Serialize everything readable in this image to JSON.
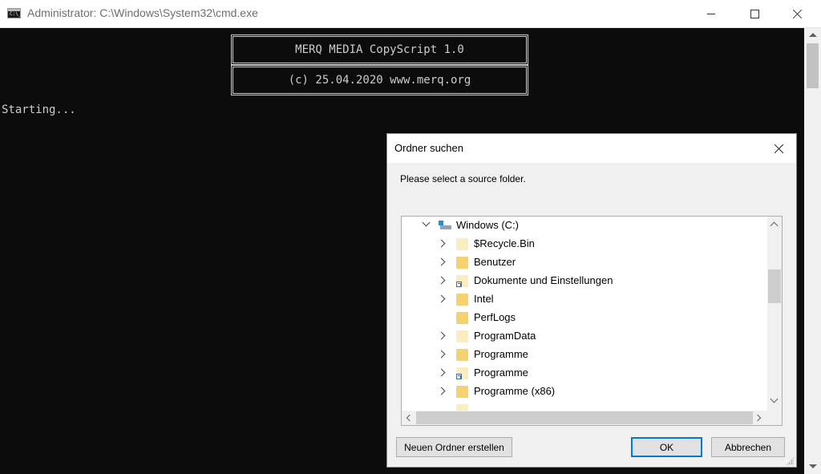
{
  "window": {
    "title": "Administrator: C:\\Windows\\System32\\cmd.exe",
    "icon": "cmd-icon",
    "icon_text": "C:\\_"
  },
  "console": {
    "banner_line1": "MERQ MEDIA CopyScript 1.0",
    "banner_line2": "(c) 25.04.2020 www.merq.org",
    "output_line": "Starting..."
  },
  "dialog": {
    "title": "Ordner suchen",
    "prompt": "Please select a source folder.",
    "tree": {
      "root": {
        "label": "Windows (C:)",
        "icon": "drive-icon",
        "expanded": true
      },
      "items": [
        {
          "label": "$Recycle.Bin",
          "icon": "folder-icon",
          "expandable": true,
          "style": "pale"
        },
        {
          "label": "Benutzer",
          "icon": "folder-icon",
          "expandable": true,
          "style": "normal"
        },
        {
          "label": "Dokumente und Einstellungen",
          "icon": "folder-shortcut-icon",
          "expandable": true,
          "style": "pale"
        },
        {
          "label": "Intel",
          "icon": "folder-icon",
          "expandable": true,
          "style": "normal"
        },
        {
          "label": "PerfLogs",
          "icon": "folder-icon",
          "expandable": false,
          "style": "normal"
        },
        {
          "label": "ProgramData",
          "icon": "folder-icon",
          "expandable": true,
          "style": "pale"
        },
        {
          "label": "Programme",
          "icon": "folder-icon",
          "expandable": true,
          "style": "normal"
        },
        {
          "label": "Programme",
          "icon": "folder-shortcut-icon",
          "expandable": true,
          "style": "pale"
        },
        {
          "label": "Programme (x86)",
          "icon": "folder-icon",
          "expandable": true,
          "style": "normal"
        }
      ]
    },
    "buttons": {
      "new_folder": "Neuen Ordner erstellen",
      "ok": "OK",
      "cancel": "Abbrechen"
    }
  },
  "colors": {
    "console_bg": "#0c0c0c",
    "console_text": "#cccccc",
    "accent": "#0078d7",
    "folder": "#f6d26e"
  }
}
